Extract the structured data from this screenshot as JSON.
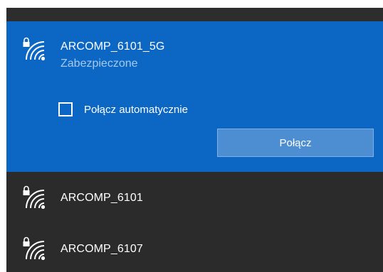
{
  "networks": {
    "selected": {
      "name": "ARCOMP_6101_5G",
      "status": "Zabezpieczone",
      "auto_connect_label": "Połącz automatycznie",
      "auto_connect_checked": false,
      "connect_label": "Połącz",
      "icon": "wifi-secured-icon"
    },
    "items": [
      {
        "name": "ARCOMP_6101",
        "icon": "wifi-secured-icon"
      },
      {
        "name": "ARCOMP_6107",
        "icon": "wifi-secured-icon"
      }
    ]
  },
  "colors": {
    "flyout_bg": "#2b2b2b",
    "selected_bg": "#0c67c4",
    "button_bg": "#4d8ed2",
    "status_text": "#a6c9ee"
  }
}
